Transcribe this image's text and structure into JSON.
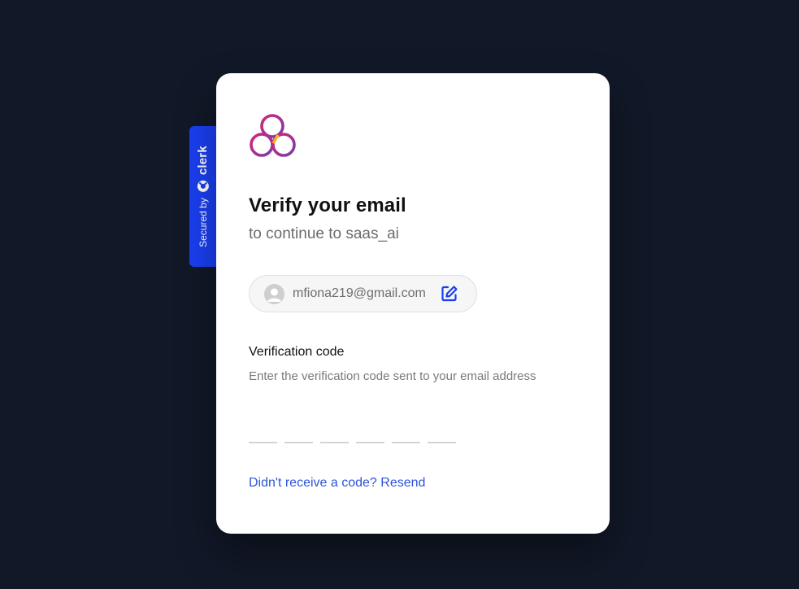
{
  "badge": {
    "secured_label": "Secured by",
    "brand_label": "clerk",
    "color": "#1a3ff0"
  },
  "card": {
    "logo_icon": "tri-ring-logo-icon",
    "title": "Verify your email",
    "subtitle": "to continue to saas_ai",
    "identity": {
      "email": "mfiona219@gmail.com",
      "avatar_icon": "user-avatar-icon",
      "edit_icon": "edit-icon"
    },
    "field": {
      "label": "Verification code",
      "hint": "Enter the verification code sent to your email address",
      "code_digits": [
        "",
        "",
        "",
        "",
        "",
        ""
      ]
    },
    "resend_label": "Didn't receive a code? Resend"
  },
  "colors": {
    "background": "#111827",
    "link": "#2c54d8",
    "accent_edit": "#1a3ff0"
  }
}
